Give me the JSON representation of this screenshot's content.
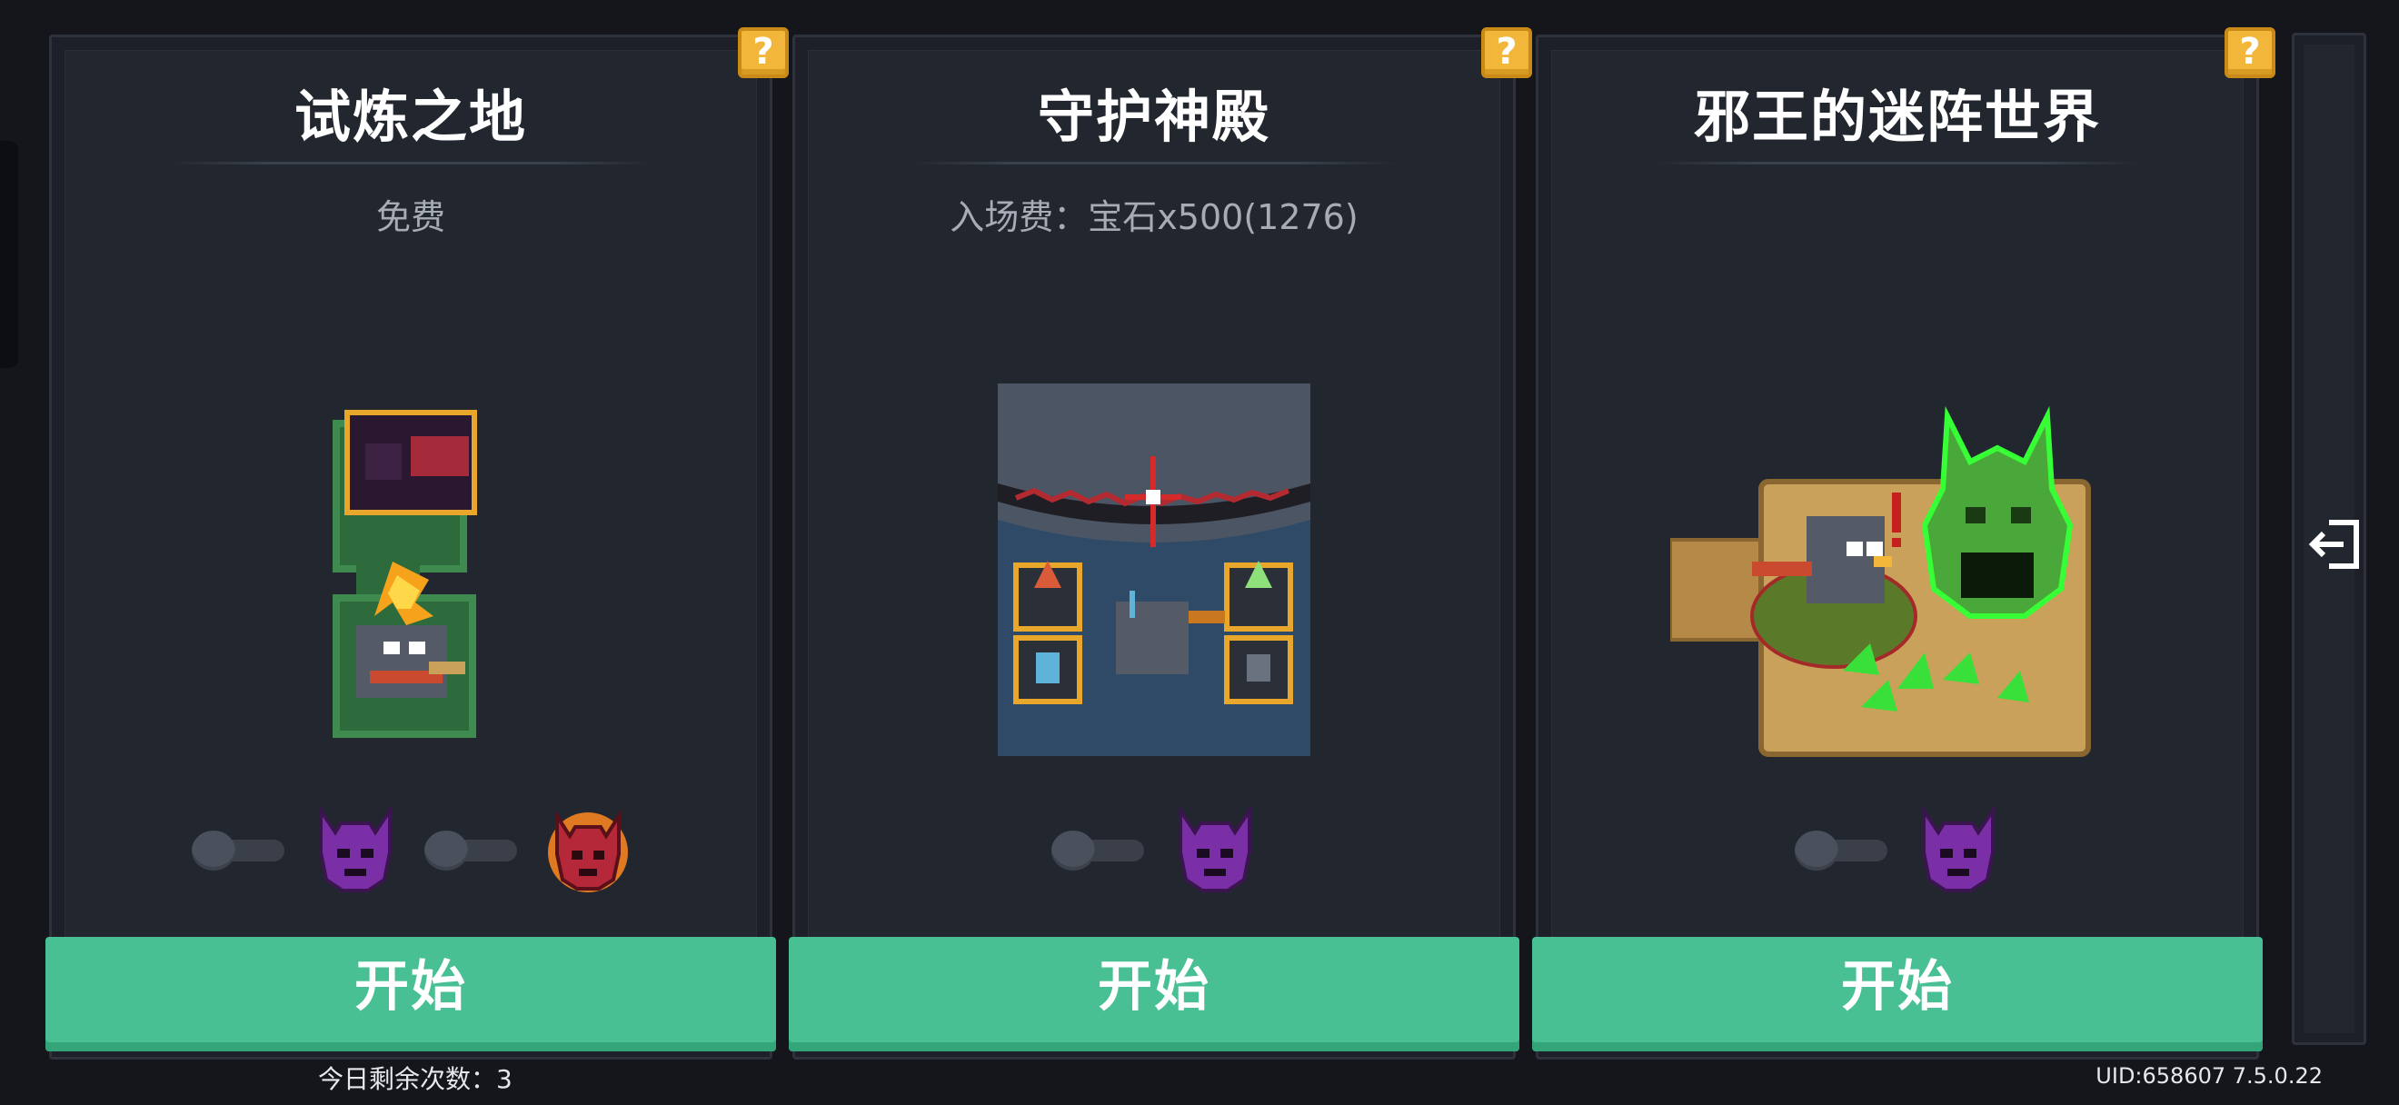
{
  "cards": [
    {
      "title": "试炼之地",
      "fee": "免费",
      "help": "?",
      "start_label": "开始",
      "toggles": 2,
      "masks": [
        "purple-demon-mask",
        "red-demon-mask"
      ]
    },
    {
      "title": "守护神殿",
      "fee": "入场费：宝石x500(1276)",
      "help": "?",
      "start_label": "开始",
      "toggles": 1,
      "masks": [
        "purple-demon-mask"
      ]
    },
    {
      "title": "邪王的迷阵世界",
      "fee": "",
      "help": "?",
      "start_label": "开始",
      "toggles": 1,
      "masks": [
        "purple-demon-mask"
      ]
    }
  ],
  "footer": {
    "daily_remaining": "今日剩余次数：3",
    "uid_version": "UID:658607 7.5.0.22"
  },
  "colors": {
    "background": "#14161b",
    "card": "#22262e",
    "start_button": "#48c093",
    "help_button": "#f2b63a"
  },
  "icons": {
    "exit": "exit-door-icon",
    "help": "question-mark-icon"
  }
}
